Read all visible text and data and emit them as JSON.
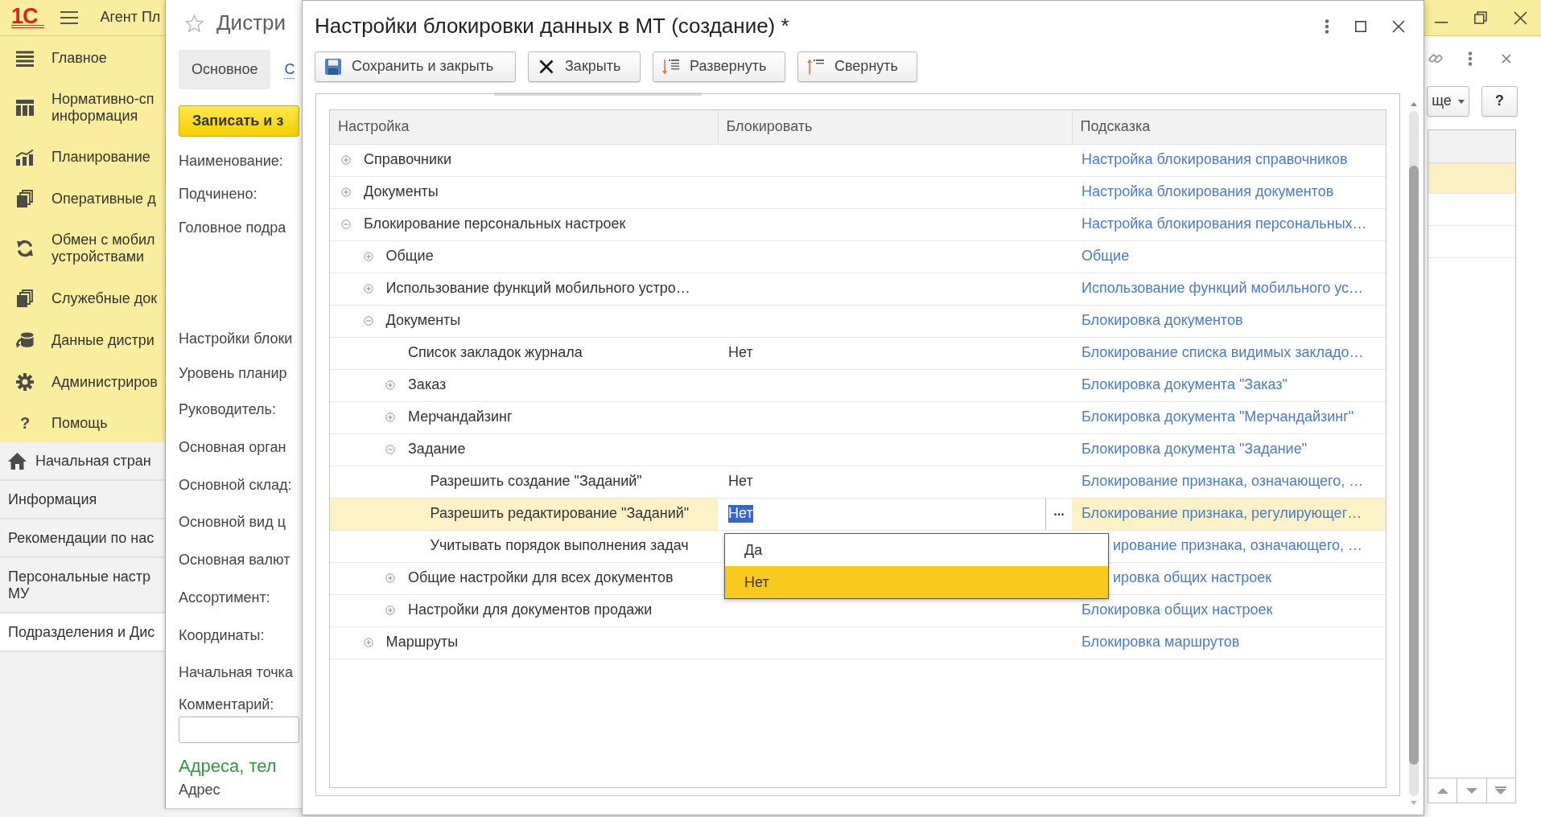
{
  "app": {
    "logo": "1С",
    "title": "Агент Пл"
  },
  "sections": [
    {
      "lines": [
        "Главное"
      ]
    },
    {
      "lines": [
        "Нормативно-сп",
        "информация"
      ]
    },
    {
      "lines": [
        "Планирование"
      ]
    },
    {
      "lines": [
        "Оперативные д"
      ]
    },
    {
      "lines": [
        "Обмен с мобил",
        "устройствами"
      ]
    },
    {
      "lines": [
        "Служебные док"
      ]
    },
    {
      "lines": [
        "Данные дистри"
      ]
    },
    {
      "lines": [
        "Администриров"
      ]
    },
    {
      "lines": [
        "Помощь"
      ],
      "glyph": "?"
    }
  ],
  "open_windows": [
    {
      "lines": [
        "Начальная стран"
      ],
      "selected": false
    },
    {
      "lines": [
        "Информация"
      ],
      "selected": false
    },
    {
      "lines": [
        "Рекомендации по нас"
      ],
      "selected": false
    },
    {
      "lines": [
        "Персональные настр",
        "МУ"
      ],
      "selected": false
    },
    {
      "lines": [
        "Подразделения и Дис"
      ],
      "selected": true
    }
  ],
  "form": {
    "title": "Дистри",
    "tabs": [
      {
        "label": "Основное",
        "selected": true
      },
      {
        "label": "С",
        "selected": false
      }
    ],
    "save_button": "Записать и з",
    "fields": [
      "Наименование:",
      "Подчинено:",
      "Головное подра",
      "Настройки блоки",
      "Уровень планир",
      "Руководитель:",
      "Основная орган",
      "Основной склад:",
      "Основной вид ц",
      "Основная валют",
      "Ассортимент:",
      "Координаты:",
      "Начальная точка"
    ],
    "comment_label": "Комментарий:",
    "section_title": "Адреса, тел",
    "address_label": "Адрес"
  },
  "right_panel": {
    "more_button": "ще",
    "help_button": "?",
    "list_rows": [
      {
        "selected": true
      },
      {
        "selected": false
      },
      {
        "selected": false
      }
    ]
  },
  "dialog": {
    "title": "Настройки блокировки данных в МТ (создание) *",
    "toolbar": [
      "Сохранить и закрыть",
      "Закрыть",
      "Развернуть",
      "Свернуть"
    ],
    "table": {
      "columns": [
        "Настройка",
        "Блокировать",
        "Подсказка"
      ],
      "rows": [
        {
          "kind": "group",
          "setting": "Справочники",
          "hint": "Настройка блокирования справочников",
          "expanded": false,
          "selected": false
        },
        {
          "kind": "group",
          "setting": "Документы",
          "hint": "Настройка блокирования документов",
          "expanded": false,
          "selected": false
        },
        {
          "kind": "group",
          "setting": "Блокирование персональных настроек",
          "hint": "Настройка блокирования персональных…",
          "expanded": true,
          "selected": false,
          "children": [
            {
              "kind": "group",
              "setting": "Общие",
              "hint": "Общие",
              "expanded": false,
              "selected": false
            },
            {
              "kind": "group",
              "setting": "Использование функций мобильного устро…",
              "hint": "Использование функций мобильного ус…",
              "expanded": false,
              "selected": false
            },
            {
              "kind": "group",
              "setting": "Документы",
              "hint": "Блокировка документов",
              "expanded": true,
              "selected": false,
              "children": [
                {
                  "kind": "setting",
                  "setting": "Список закладок журнала",
                  "value": "Нет",
                  "hint": "Блокирование списка видимых закладо…",
                  "selected": false
                },
                {
                  "kind": "group",
                  "setting": "Заказ",
                  "hint": "Блокировка документа \"Заказ\"",
                  "expanded": false,
                  "selected": false
                },
                {
                  "kind": "group",
                  "setting": "Мерчандайзинг",
                  "hint": "Блокировка документа \"Мерчандайзинг\"",
                  "expanded": false,
                  "selected": false
                },
                {
                  "kind": "group",
                  "setting": "Задание",
                  "hint": "Блокировка документа \"Задание\"",
                  "expanded": true,
                  "selected": false,
                  "children": [
                    {
                      "kind": "setting",
                      "setting": "Разрешить создание \"Заданий\"",
                      "value": "Нет",
                      "hint": "Блокирование признака, означающего, …",
                      "selected": false
                    },
                    {
                      "kind": "setting",
                      "setting": "Разрешить редактирование \"Заданий\"",
                      "value": "Нет",
                      "hint": "Блокирование признака, регулирующег…",
                      "selected": true
                    },
                    {
                      "kind": "setting",
                      "setting": "Учитывать порядок выполнения задач",
                      "hint": "ирование признака, означающего, …",
                      "selected": false
                    }
                  ]
                },
                {
                  "kind": "group",
                  "setting": "Общие настройки для всех документов",
                  "hint": "ировка общих настроек",
                  "expanded": false,
                  "selected": false
                },
                {
                  "kind": "group",
                  "setting": "Настройки для документов продажи",
                  "hint": "Блокировка общих настроек",
                  "expanded": false,
                  "selected": false
                }
              ]
            },
            {
              "kind": "group",
              "setting": "Маршруты",
              "hint": "Блокировка маршрутов",
              "expanded": false,
              "selected": false
            }
          ]
        }
      ]
    },
    "choice_button": "...",
    "dropdown": [
      {
        "label": "Да",
        "selected": false
      },
      {
        "label": "Нет",
        "selected": true
      }
    ]
  }
}
